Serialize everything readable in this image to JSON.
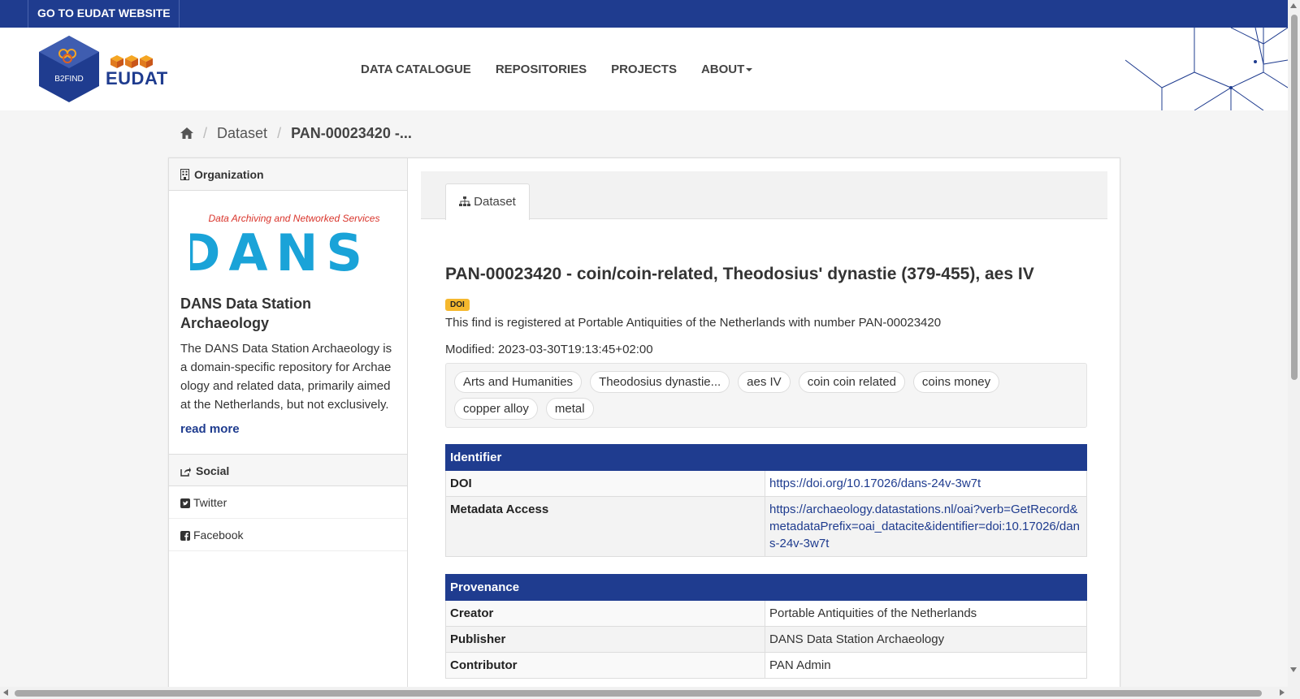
{
  "topbar": {
    "link": "GO TO EUDAT WEBSITE"
  },
  "header": {
    "logo_b2find": "B2FIND",
    "logo_eudat": "EUDAT",
    "nav": [
      "DATA CATALOGUE",
      "REPOSITORIES",
      "PROJECTS",
      "ABOUT"
    ]
  },
  "breadcrumb": {
    "items": [
      "Dataset",
      "PAN-00023420 -..."
    ]
  },
  "aside": {
    "organization_heading": "Organization",
    "org_logo_tagline": "Data Archiving and Networked Services",
    "org_logo_text": "DANS",
    "org_title": "DANS Data Station Archaeology",
    "org_description": "The DANS Data Station Archaeology is a domain-specific repository for Archaeology and related data, primarily aimed at the Netherlands, but not exclusively.",
    "read_more": "read more",
    "social_heading": "Social",
    "social": [
      "Twitter",
      "Facebook"
    ]
  },
  "dataset": {
    "tab": "Dataset",
    "title": "PAN-00023420 - coin/coin-related, Theodosius' dynastie (379-455), aes IV",
    "badge": "DOI",
    "notes": "This find is registered at Portable Antiquities of the Netherlands with number PAN-00023420",
    "modified": "Modified: 2023-03-30T19:13:45+02:00",
    "tags": [
      "Arts and Humanities",
      "Theodosius dynastie...",
      "aes IV",
      "coin coin related",
      "coins money",
      "copper alloy",
      "metal"
    ]
  },
  "identifier": {
    "heading": "Identifier",
    "rows": [
      {
        "key": "DOI",
        "value": "https://doi.org/10.17026/dans-24v-3w7t"
      },
      {
        "key": "Metadata Access",
        "value": "https://archaeology.datastations.nl/oai?verb=GetRecord&metadataPrefix=oai_datacite&identifier=doi:10.17026/dans-24v-3w7t"
      }
    ]
  },
  "provenance": {
    "heading": "Provenance",
    "rows": [
      {
        "key": "Creator",
        "value": "Portable Antiquities of the Netherlands"
      },
      {
        "key": "Publisher",
        "value": "DANS Data Station Archaeology"
      },
      {
        "key": "Contributor",
        "value": "PAN Admin"
      }
    ]
  },
  "colors": {
    "brand": "#1f3c8f",
    "badge": "#f5b82e",
    "dans": "#1aa3d8",
    "tagline": "#d9342b"
  }
}
